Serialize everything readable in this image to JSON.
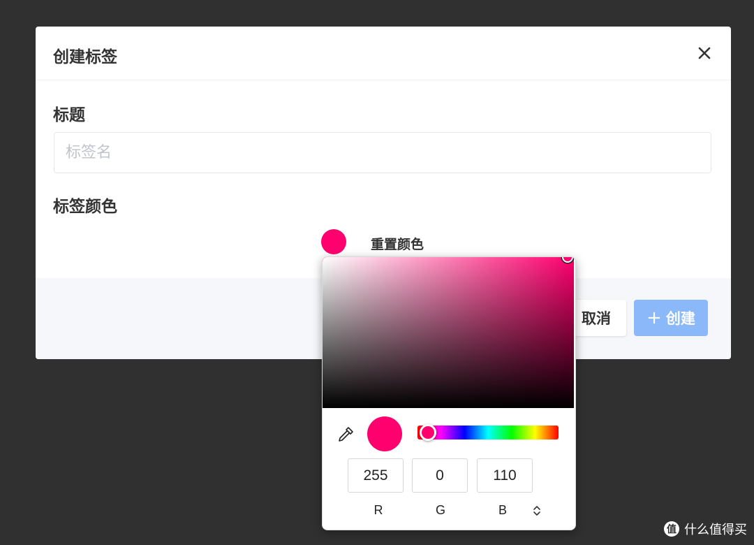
{
  "dialog": {
    "title": "创建标签",
    "title_field_label": "标题",
    "title_placeholder": "标签名",
    "title_value": "",
    "color_field_label": "标签颜色",
    "reset_color_label": "重置颜色",
    "cancel_label": "取消",
    "create_label": "创建",
    "create_icon": "plus-icon",
    "close_icon": "close-icon"
  },
  "color_picker": {
    "current_color": "#ff006e",
    "r": "255",
    "g": "0",
    "b": "110",
    "r_label": "R",
    "g_label": "G",
    "b_label": "B",
    "eyedropper_icon": "eyedropper-icon",
    "mode_toggle_icon": "chevron-up-down-icon"
  },
  "watermark": {
    "text": "什么值得买"
  },
  "colors": {
    "backdrop": "#303030",
    "primary_disabled": "#8ab8f9",
    "footer_bg": "#f5f7fa"
  }
}
